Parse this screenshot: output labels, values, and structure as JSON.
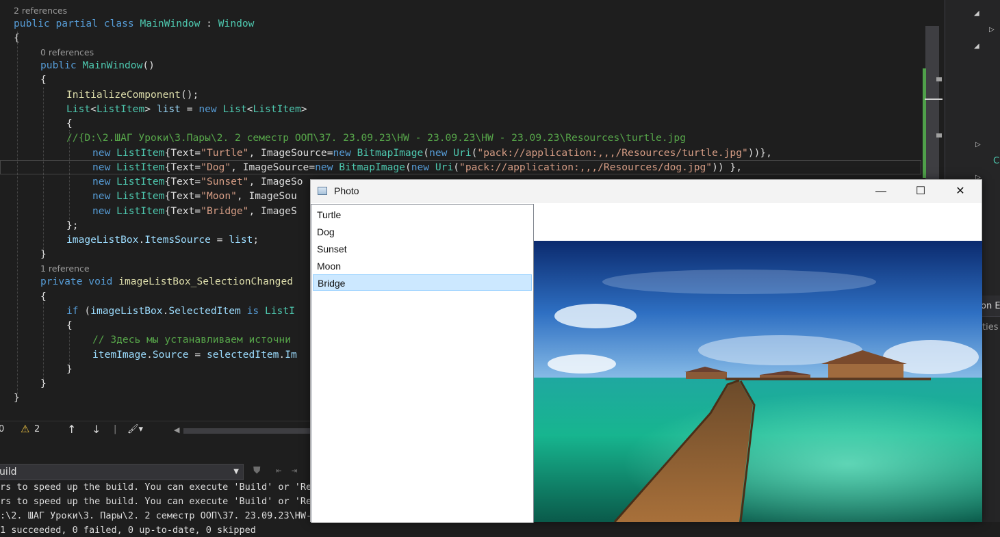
{
  "editor": {
    "lenses": {
      "class_refs": "2 references",
      "ctor_refs": "0 references",
      "handler_refs": "1 reference"
    },
    "lines": {
      "l1": [
        [
          "kw",
          "public partial class "
        ],
        [
          "ty",
          "MainWindow"
        ],
        [
          "pl",
          " : "
        ],
        [
          "ty",
          "Window"
        ]
      ],
      "l2": [
        [
          "pl",
          "{"
        ]
      ],
      "l3": [
        [
          "kw",
          "public "
        ],
        [
          "ty",
          "MainWindow"
        ],
        [
          "pl",
          "()"
        ]
      ],
      "l4": [
        [
          "pl",
          "{"
        ]
      ],
      "l5": [
        [
          "fn",
          "InitializeComponent"
        ],
        [
          "pl",
          "();"
        ]
      ],
      "l6": [
        [
          "ty",
          "List"
        ],
        [
          "pl",
          "<"
        ],
        [
          "ty",
          "ListItem"
        ],
        [
          "pl",
          "> "
        ],
        [
          "vr",
          "list"
        ],
        [
          "pl",
          " = "
        ],
        [
          "kw",
          "new "
        ],
        [
          "ty",
          "List"
        ],
        [
          "pl",
          "<"
        ],
        [
          "ty",
          "ListItem"
        ],
        [
          "pl",
          ">"
        ]
      ],
      "l7": [
        [
          "pl",
          "{"
        ]
      ],
      "l8": [
        [
          "cm",
          "//{D:\\2.ШАГ Уроки\\3.Пары\\2. 2 семестр ООП\\37. 23.09.23\\HW - 23.09.23\\HW - 23.09.23\\Resources\\turtle.jpg"
        ]
      ],
      "l9": [
        [
          "kw",
          "new "
        ],
        [
          "ty",
          "ListItem"
        ],
        [
          "pl",
          "{Text="
        ],
        [
          "st",
          "\"Turtle\""
        ],
        [
          "pl",
          ", ImageSource="
        ],
        [
          "kw",
          "new "
        ],
        [
          "ty",
          "BitmapImage"
        ],
        [
          "pl",
          "("
        ],
        [
          "kw",
          "new "
        ],
        [
          "ty",
          "Uri"
        ],
        [
          "pl",
          "("
        ],
        [
          "st",
          "\"pack://application:,,,/Resources/turtle.jpg\""
        ],
        [
          "pl",
          "))},"
        ]
      ],
      "l10": [
        [
          "kw",
          "new "
        ],
        [
          "ty",
          "ListItem"
        ],
        [
          "pl",
          "{Text="
        ],
        [
          "st",
          "\"Dog\""
        ],
        [
          "pl",
          ", ImageSource="
        ],
        [
          "kw",
          "new "
        ],
        [
          "ty",
          "BitmapImage"
        ],
        [
          "pl",
          "("
        ],
        [
          "kw",
          "new "
        ],
        [
          "ty",
          "Uri"
        ],
        [
          "pl",
          "("
        ],
        [
          "st",
          "\"pack://application:,,,/Resources/dog.jpg\""
        ],
        [
          "pl",
          ")) },"
        ]
      ],
      "l11": [
        [
          "kw",
          "new "
        ],
        [
          "ty",
          "ListItem"
        ],
        [
          "pl",
          "{Text="
        ],
        [
          "st",
          "\"Sunset\""
        ],
        [
          "pl",
          ", ImageSo"
        ]
      ],
      "l12": [
        [
          "kw",
          "new "
        ],
        [
          "ty",
          "ListItem"
        ],
        [
          "pl",
          "{Text="
        ],
        [
          "st",
          "\"Moon\""
        ],
        [
          "pl",
          ", ImageSou"
        ]
      ],
      "l13": [
        [
          "kw",
          "new "
        ],
        [
          "ty",
          "ListItem"
        ],
        [
          "pl",
          "{Text="
        ],
        [
          "st",
          "\"Bridge\""
        ],
        [
          "pl",
          ", ImageS"
        ]
      ],
      "l14": [
        [
          "pl",
          "};"
        ]
      ],
      "l15": [
        [
          "vr",
          "imageListBox"
        ],
        [
          "pl",
          "."
        ],
        [
          "vr",
          "ItemsSource"
        ],
        [
          "pl",
          " = "
        ],
        [
          "vr",
          "list"
        ],
        [
          "pl",
          ";"
        ]
      ],
      "l16": [
        [
          "pl",
          "}"
        ]
      ],
      "l17": [
        [
          "kw",
          "private void "
        ],
        [
          "fn",
          "imageListBox_SelectionChanged"
        ]
      ],
      "l18": [
        [
          "pl",
          "{"
        ]
      ],
      "l19": [
        [
          "kw",
          "if "
        ],
        [
          "pl",
          "("
        ],
        [
          "vr",
          "imageListBox"
        ],
        [
          "pl",
          "."
        ],
        [
          "vr",
          "SelectedItem"
        ],
        [
          "kw",
          " is "
        ],
        [
          "ty",
          "ListI"
        ]
      ],
      "l20": [
        [
          "pl",
          "{"
        ]
      ],
      "l21": [
        [
          "cm",
          "// Здесь мы устанавливаем источни"
        ]
      ],
      "l22": [
        [
          "vr",
          "itemImage"
        ],
        [
          "pl",
          "."
        ],
        [
          "vr",
          "Source"
        ],
        [
          "pl",
          " = "
        ],
        [
          "vr",
          "selectedItem"
        ],
        [
          "pl",
          "."
        ],
        [
          "vr",
          "Im"
        ]
      ],
      "l23": [
        [
          "pl",
          "}"
        ]
      ],
      "l24": [
        [
          "pl",
          "}"
        ]
      ],
      "l25": [
        [
          "pl",
          "}"
        ]
      ]
    }
  },
  "status_bar": {
    "errors": "0",
    "warnings": "2",
    "up_icon": "arrow-up-icon",
    "down_icon": "arrow-down-icon",
    "brush_icon": "code-cleanup-icon"
  },
  "output": {
    "source_select": "uild",
    "lines": [
      "rs to speed up the build. You can execute 'Build' or 'Reb",
      "rs to speed up the build. You can execute 'Build' or 'Reb",
      ":\\2. ШАГ Уроки\\3. Пары\\2. 2 семестр ООП\\37. 23.09.23\\HW-2",
      "1 succeeded, 0 failed, 0 up-to-date, 0 skipped"
    ]
  },
  "right_panel": {
    "label_1": "on E",
    "label_2": "ties",
    "green_char": "C"
  },
  "photo_window": {
    "title": "Photo",
    "minimize": "—",
    "maximize": "☐",
    "close": "✕",
    "items": [
      "Turtle",
      "Dog",
      "Sunset",
      "Moon",
      "Bridge"
    ],
    "selected_index": 4,
    "image_name": "bridge-over-lagoon-photo"
  },
  "colors": {
    "keyword": "#569cd6",
    "type": "#4ec9b0",
    "string": "#d69d85",
    "comment": "#57a64a",
    "selection": "#cce8ff"
  }
}
